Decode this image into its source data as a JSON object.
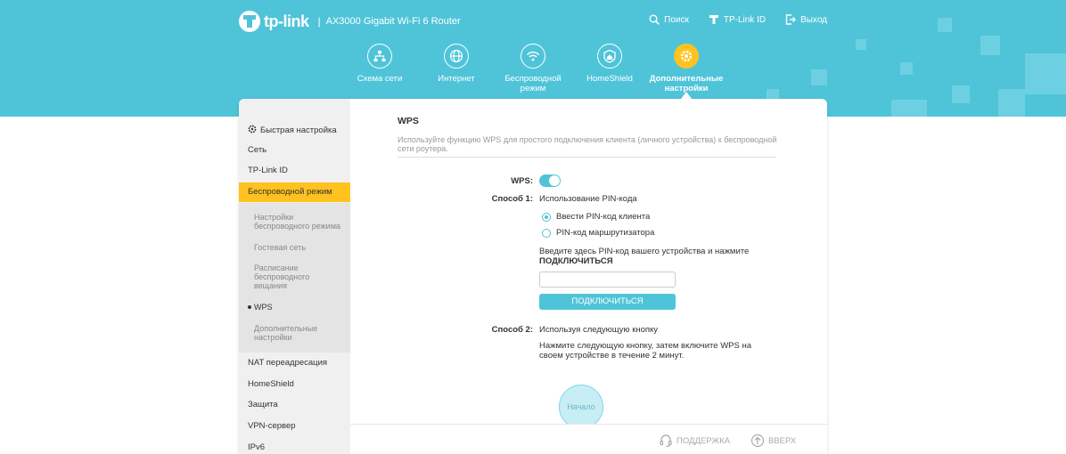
{
  "header": {
    "brand": "tp-link",
    "separator": "|",
    "product": "AX3000 Gigabit Wi-Fi 6 Router",
    "top_links": [
      {
        "label": "Поиск",
        "icon": "search-icon"
      },
      {
        "label": "TP-Link ID",
        "icon": "tplink-id-icon"
      },
      {
        "label": "Выход",
        "icon": "logout-icon"
      }
    ]
  },
  "main_nav": [
    {
      "label": "Схема сети",
      "icon": "network-map-icon"
    },
    {
      "label": "Интернет",
      "icon": "globe-icon"
    },
    {
      "label": "Беспроводной режим",
      "icon": "wifi-icon"
    },
    {
      "label": "HomeShield",
      "icon": "homeshield-icon"
    },
    {
      "label": "Дополнительные настройки",
      "icon": "advanced-gear-icon",
      "active": true
    }
  ],
  "sidebar": {
    "quick_setup": "Быстрая настройка",
    "items": [
      "Сеть",
      "TP-Link ID",
      "Беспроводной режим"
    ],
    "sub_items": [
      "Настройки беспроводного режима",
      "Гостевая сеть",
      "Расписание беспроводного вещания",
      "WPS",
      "Дополнительные настройки"
    ],
    "items_after": [
      "NAT переадресация",
      "HomeShield",
      "Защита",
      "VPN-сервер",
      "IPv6"
    ]
  },
  "content": {
    "title": "WPS",
    "description": "Используйте функцию WPS для простого подключения клиента (личного устройства) к беспроводной сети роутера.",
    "wps_label": "WPS:",
    "wps_enabled": true,
    "method1_label": "Способ 1:",
    "method1_value": "Использование PIN-кода",
    "radio_client_pin": "Ввести PIN-код клиента",
    "radio_router_pin": "PIN-код маршрутизатора",
    "pin_hint": "Введите здесь PIN-код вашего устройства и нажмите",
    "pin_hint_bold": "ПОДКЛЮЧИТЬСЯ",
    "pin_value": "",
    "connect_button": "ПОДКЛЮЧИТЬСЯ",
    "method2_label": "Способ 2:",
    "method2_value": "Используя следующую кнопку",
    "method2_hint": "Нажмите следующую кнопку, затем включите WPS на своем устройстве в течение 2 минут.",
    "start_button": "Начало"
  },
  "footer": {
    "support": "ПОДДЕРЖКА",
    "up": "ВВЕРХ"
  },
  "colors": {
    "accent": "#4fc4d9",
    "active": "#ffc21f"
  }
}
